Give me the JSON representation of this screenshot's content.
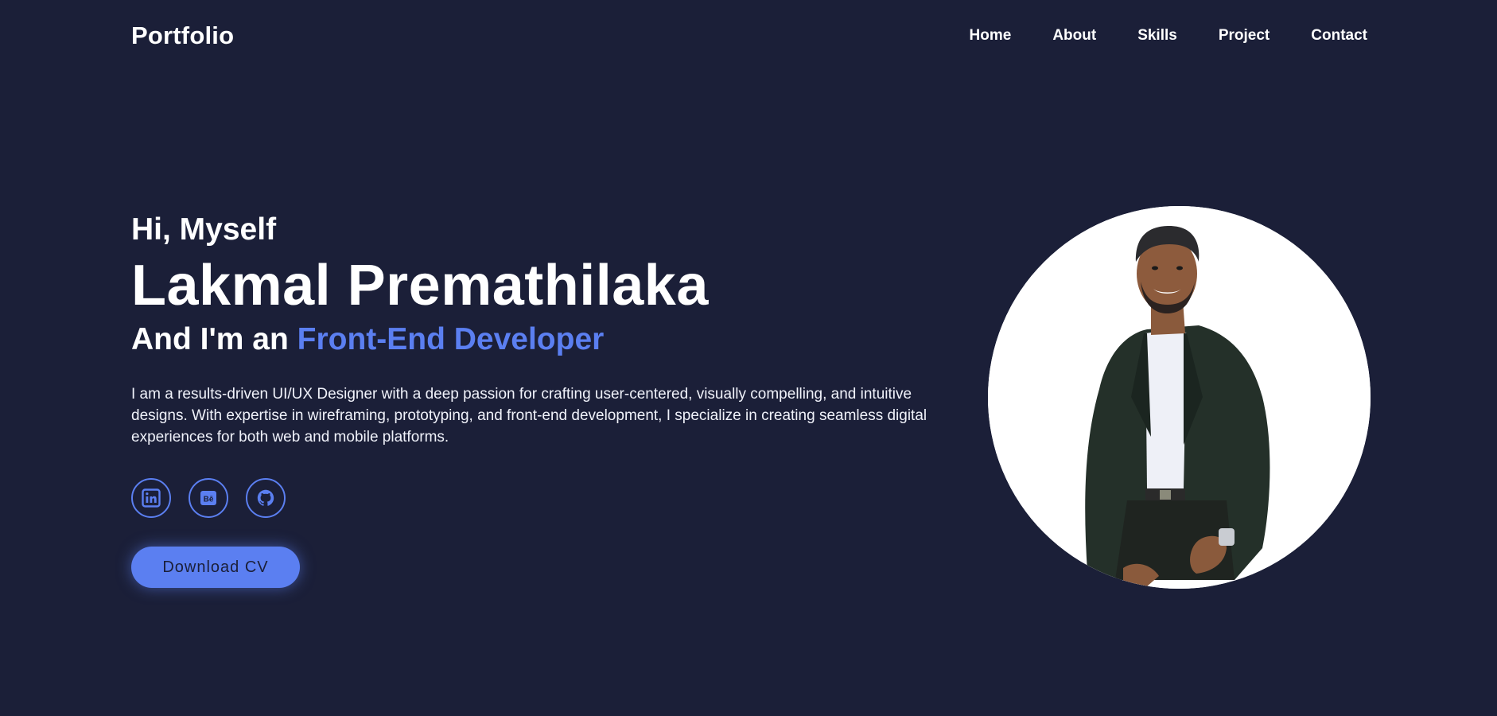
{
  "header": {
    "logo": "Portfolio",
    "nav": [
      "Home",
      "About",
      "Skills",
      "Project",
      "Contact"
    ]
  },
  "hero": {
    "greeting": "Hi, Myself",
    "name": "Lakmal Premathilaka",
    "role_prefix": "And I'm an",
    "role_highlight": "Front-End Developer",
    "bio": "I am a results-driven UI/UX Designer with a deep passion for crafting user-centered, visually compelling, and intuitive designs. With expertise in wireframing, prototyping, and front-end development, I specialize in creating seamless digital experiences for both web and mobile platforms.",
    "socials": [
      "linkedin-icon",
      "behance-icon",
      "github-icon"
    ],
    "cv_button": "Download CV"
  },
  "colors": {
    "background": "#1b1f38",
    "accent": "#5b7ff1",
    "text": "#ffffff"
  }
}
